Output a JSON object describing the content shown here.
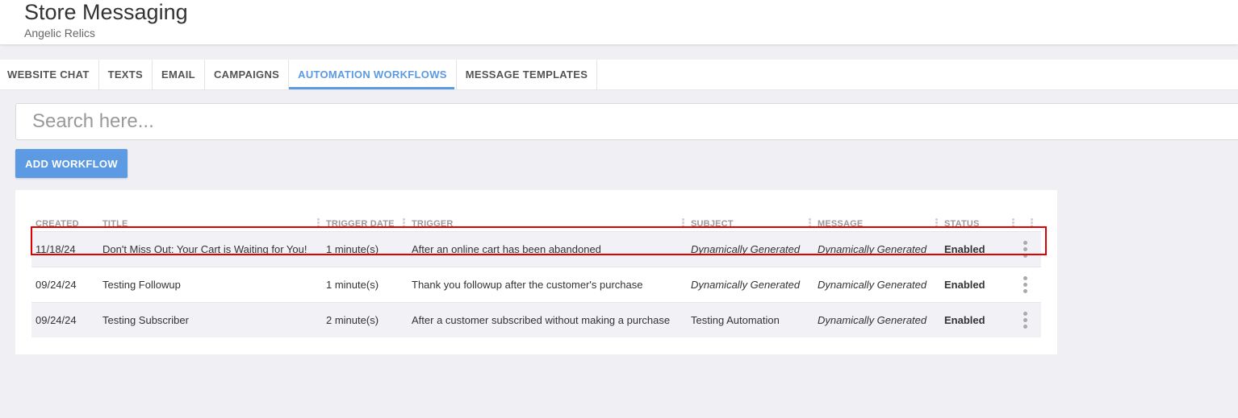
{
  "header": {
    "title": "Store Messaging",
    "subtitle": "Angelic Relics"
  },
  "tabs": [
    {
      "label": "WEBSITE CHAT",
      "active": false
    },
    {
      "label": "TEXTS",
      "active": false
    },
    {
      "label": "EMAIL",
      "active": false
    },
    {
      "label": "CAMPAIGNS",
      "active": false
    },
    {
      "label": "AUTOMATION WORKFLOWS",
      "active": true
    },
    {
      "label": "MESSAGE TEMPLATES",
      "active": false
    }
  ],
  "search": {
    "placeholder": "Search here...",
    "value": ""
  },
  "add_button": {
    "label": "ADD WORKFLOW"
  },
  "table": {
    "columns": [
      "CREATED",
      "TITLE",
      "TRIGGER DATE",
      "TRIGGER",
      "SUBJECT",
      "MESSAGE",
      "STATUS"
    ],
    "rows": [
      {
        "created": "11/18/24",
        "title": "Don't Miss Out: Your Cart is Waiting for You!",
        "trigger_date": "1 minute(s)",
        "trigger": "After an online cart has been abandoned",
        "subject": "Dynamically Generated",
        "message": "Dynamically Generated",
        "status": "Enabled"
      },
      {
        "created": "09/24/24",
        "title": "Testing Followup",
        "trigger_date": "1 minute(s)",
        "trigger": "Thank you followup after the customer's purchase",
        "subject": "Dynamically Generated",
        "message": "Dynamically Generated",
        "status": "Enabled"
      },
      {
        "created": "09/24/24",
        "title": "Testing Subscriber",
        "trigger_date": "2 minute(s)",
        "trigger": "After a customer subscribed without making a purchase",
        "subject": "Testing Automation",
        "message": "Dynamically Generated",
        "status": "Enabled"
      }
    ]
  },
  "colors": {
    "accent": "#5c9ae3",
    "enabled": "#4caf50",
    "highlight": "#e00000"
  }
}
